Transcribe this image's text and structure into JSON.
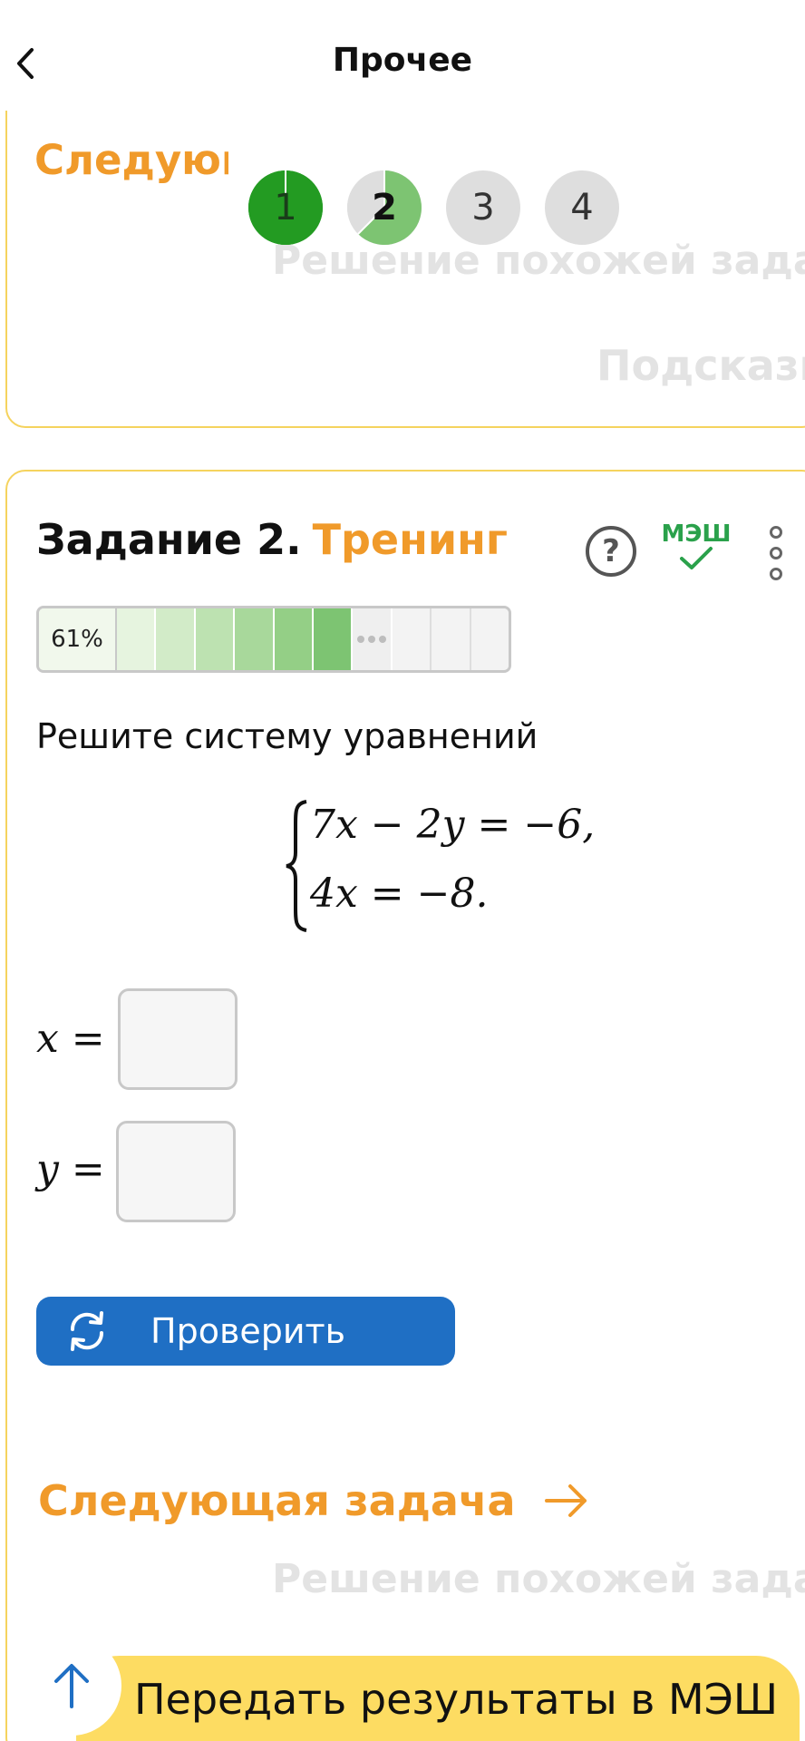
{
  "header": {
    "title": "Прочее"
  },
  "previous_card": {
    "next_label": "Следующая задача",
    "similar_label": "Решение похожей задачи",
    "hint_label": "Подсказка"
  },
  "steps": [
    "1",
    "2",
    "3",
    "4"
  ],
  "task": {
    "label": "Задание 2.",
    "kind": "Тренинг",
    "help_glyph": "?",
    "mesh_label": "МЭШ",
    "progress_percent": "61%",
    "prompt": "Решите систему уравнений",
    "equations": [
      "7x − 2y = −6,",
      "4x = −8."
    ],
    "answer_x_label": "x =",
    "answer_y_label": "y =",
    "answer_x_value": "",
    "answer_y_value": "",
    "check_label": "Проверить",
    "next_label": "Следующая задача",
    "similar_label": "Решение похожей задачи"
  },
  "bottom": {
    "send_label": "Передать результаты в МЭШ"
  },
  "colors": {
    "accent_orange": "#f09a2a",
    "card_border": "#f5d35e",
    "button_blue": "#1f6fc4",
    "bar_yellow": "#fddc62",
    "mesh_green": "#2aa14b",
    "step_done": "#239b22",
    "step_partial": "#7dc472"
  }
}
